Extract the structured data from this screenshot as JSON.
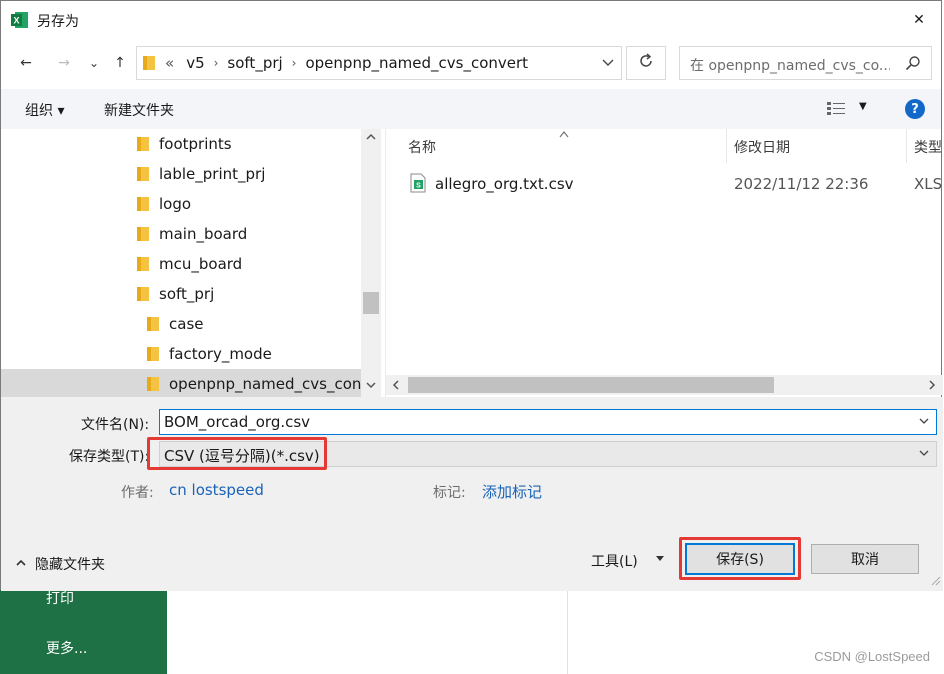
{
  "dialog": {
    "title": "另存为",
    "close_glyph": "✕"
  },
  "nav": {
    "back_glyph": "←",
    "forward_glyph": "→",
    "recent_glyph": "⌄",
    "up_glyph": "↑",
    "overflow": "«",
    "breadcrumbs": [
      "v5",
      "soft_prj",
      "openpnp_named_cvs_convert"
    ],
    "separator": "›",
    "search_placeholder": "在 openpnp_named_cvs_co..."
  },
  "toolbar": {
    "organize": "组织 ▾",
    "new_folder": "新建文件夹",
    "view_dropdown": "▼",
    "help": "?"
  },
  "tree": {
    "items": [
      {
        "label": "footprints",
        "level": 1
      },
      {
        "label": "lable_print_prj",
        "level": 1
      },
      {
        "label": "logo",
        "level": 1
      },
      {
        "label": "main_board",
        "level": 1
      },
      {
        "label": "mcu_board",
        "level": 1
      },
      {
        "label": "soft_prj",
        "level": 1
      },
      {
        "label": "case",
        "level": 2
      },
      {
        "label": "factory_mode",
        "level": 2
      },
      {
        "label": "openpnp_named_cvs_conv",
        "level": 2,
        "selected": true
      }
    ]
  },
  "filelist": {
    "columns": {
      "name": "名称",
      "modified": "修改日期",
      "type": "类型"
    },
    "files": [
      {
        "name": "allegro_org.txt.csv",
        "modified": "2022/11/12 22:36",
        "type": "XLS"
      }
    ]
  },
  "form": {
    "filename_label": "文件名(N):",
    "filename_value": "BOM_orcad_org.csv",
    "filetype_label": "保存类型(T):",
    "filetype_value": "CSV (逗号分隔)(*.csv)",
    "author_label": "作者:",
    "author_value": "cn lostspeed",
    "tags_label": "标记:",
    "tags_value": "添加标记",
    "hide_folders": "隐藏文件夹",
    "tools": "工具(L)",
    "save": "保存(S)",
    "cancel": "取消"
  },
  "background": {
    "print": "打印",
    "more": "更多...",
    "watermark": "CSDN @LostSpeed"
  },
  "colors": {
    "excel_green": "#1e7145",
    "accent_blue": "#0078d7",
    "highlight_red": "#e53935",
    "link_blue": "#1a63b8"
  }
}
